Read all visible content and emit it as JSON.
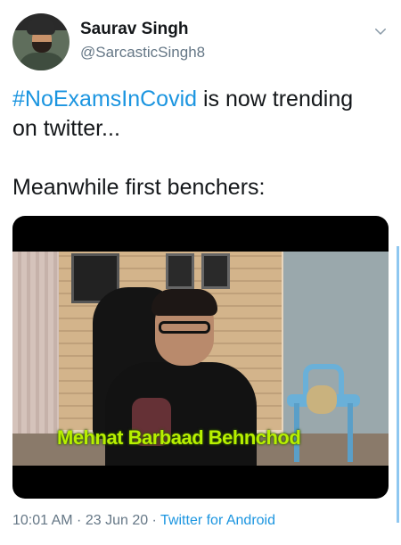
{
  "tweet": {
    "author_name": "Saurav Singh",
    "author_handle": "@SarcasticSingh8",
    "hashtag": "#NoExamsInCovid",
    "text_after_hashtag": " is now trending",
    "text_line2": "on twitter...",
    "text_line3": "Meanwhile first benchers:",
    "media_caption": "Mehnat Barbaad Behnchod",
    "timestamp": "10:01 AM",
    "date": "23 Jun 20",
    "source": "Twitter for Android",
    "separator": " · "
  },
  "icons": {
    "menu": "chevron-down-icon",
    "avatar": "avatar"
  },
  "colors": {
    "link": "#1b95e0",
    "secondary_text": "#657786",
    "primary_text": "#14171a",
    "caption": "#b8f000"
  }
}
